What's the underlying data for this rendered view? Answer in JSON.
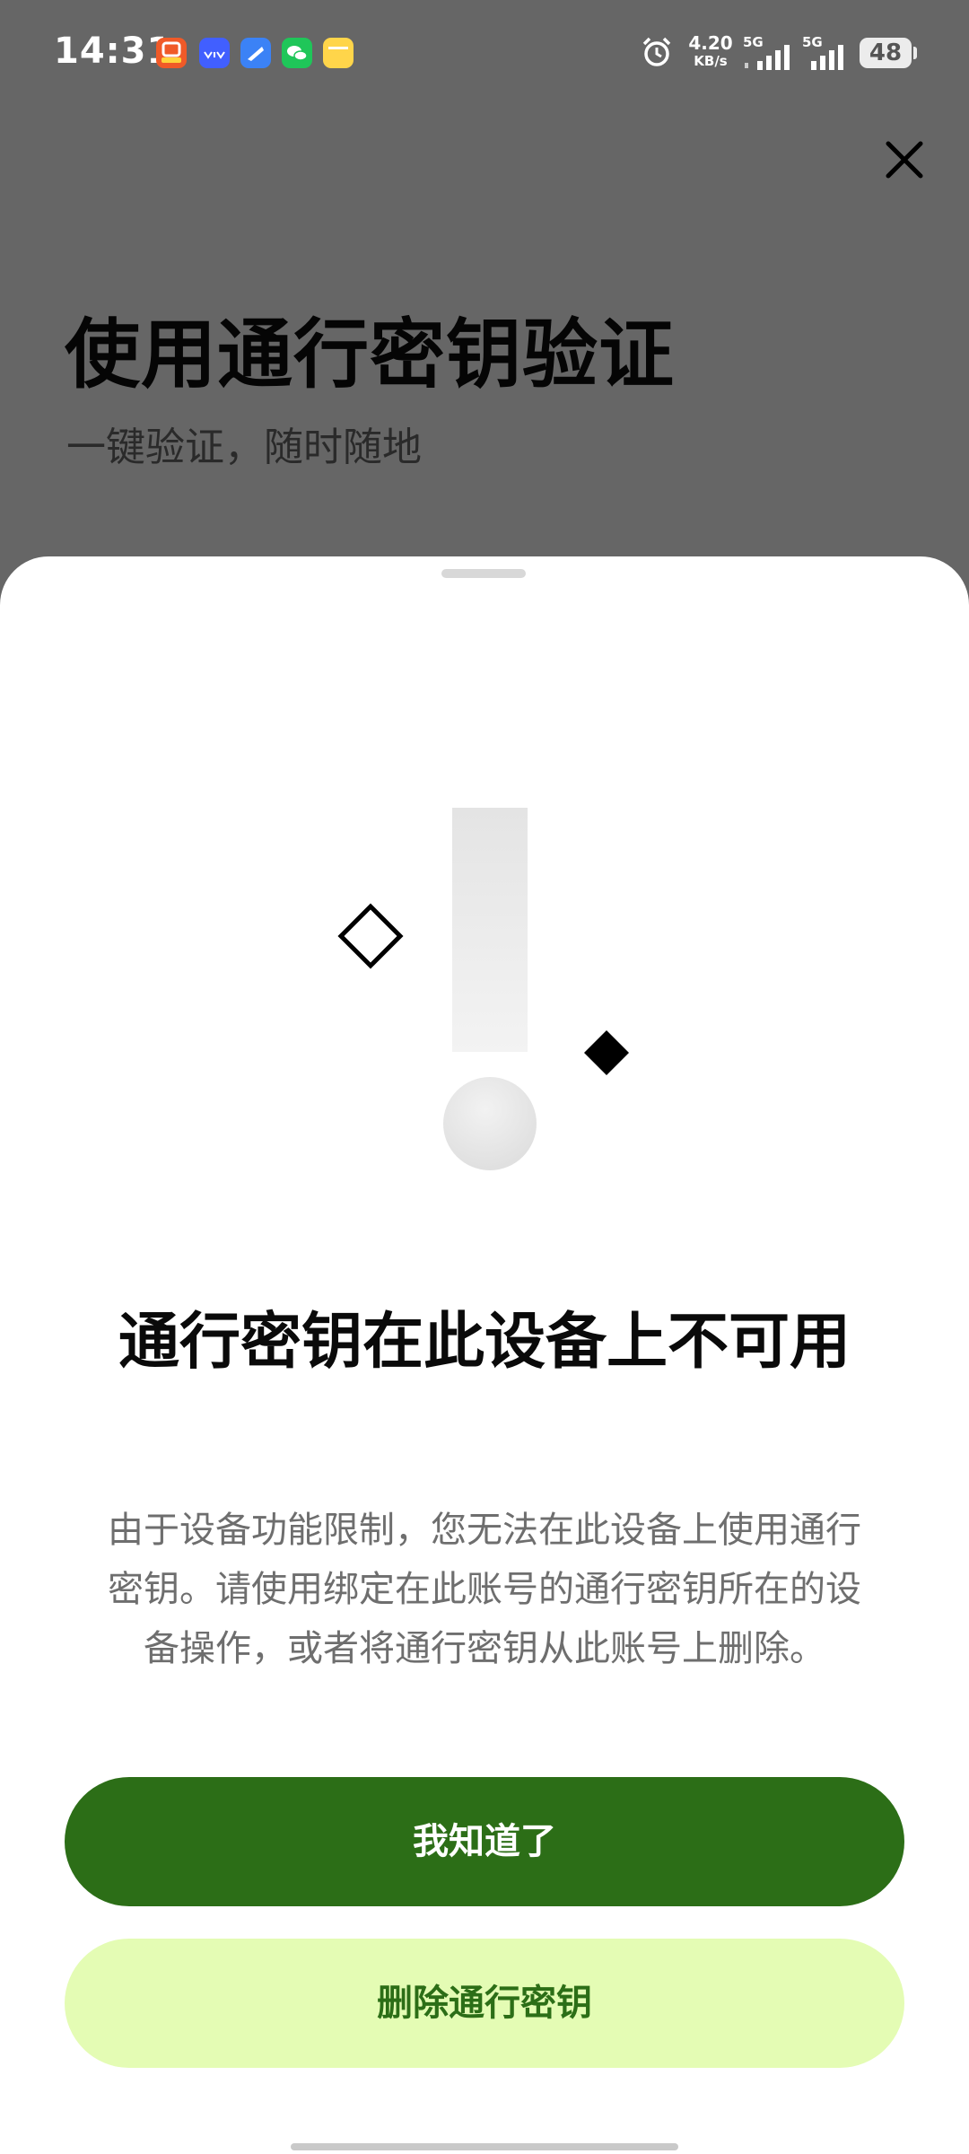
{
  "status_bar": {
    "time": "14:31",
    "net_speed_value": "4.20",
    "net_speed_unit": "KB/s",
    "signal1_label": "5G",
    "signal2_label": "5G",
    "battery_level": "48",
    "icons": [
      "app-icon-red",
      "app-icon-vivo",
      "app-icon-blue",
      "wechat-icon",
      "app-icon-yellow",
      "alarm-icon"
    ]
  },
  "header": {
    "title": "使用通行密钥验证",
    "subtitle": "一键验证，随时随地"
  },
  "sheet": {
    "title": "通行密钥在此设备上不可用",
    "description": "由于设备功能限制，您无法在此设备上使用通行密钥。请使用绑定在此账号的通行密钥所在的设备操作，或者将通行密钥从此账号上删除。",
    "primary_button_label": "我知道了",
    "secondary_button_label": "删除通行密钥",
    "illustration_icon": "exclamation-icon"
  },
  "colors": {
    "overlay": "#666666",
    "primary": "#2c6e17",
    "secondary_bg": "#e4fcb4",
    "secondary_text": "#2c6e17"
  }
}
